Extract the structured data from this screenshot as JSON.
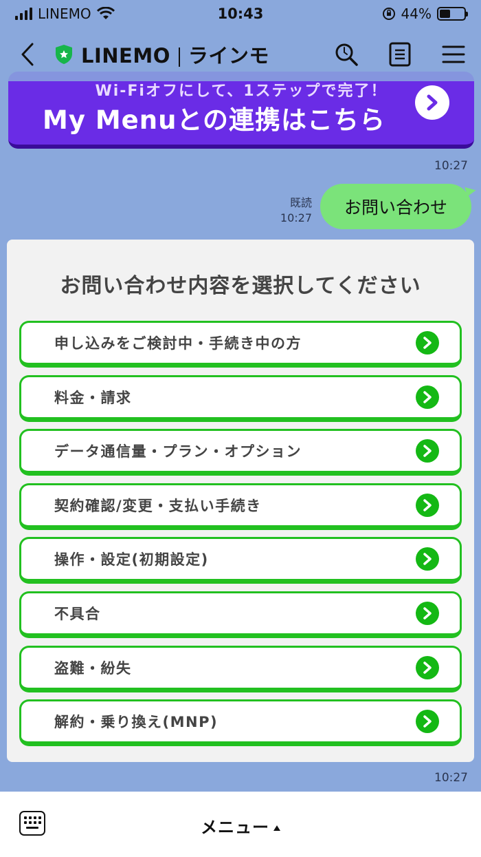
{
  "status": {
    "carrier": "LINEMO",
    "time": "10:43",
    "battery": "44%",
    "battery_level": 0.44
  },
  "header": {
    "title": "LINEMO",
    "subtitle": "ラインモ"
  },
  "banner": {
    "top_text": "Wi-Fiオフにして、1ステップで完了！",
    "main_text": "My Menuとの連携はこちら"
  },
  "messages": {
    "banner_time": "10:27",
    "read_label": "既読",
    "sent_time": "10:27",
    "sent_text": "お問い合わせ",
    "card_time": "10:27"
  },
  "inquiry": {
    "title": "お問い合わせ内容を選択してください",
    "options": [
      "申し込みをご検討中・手続き中の方",
      "料金・請求",
      "データ通信量・プラン・オプション",
      "契約確認/変更・支払い手続き",
      "操作・設定(初期設定)",
      "不具合",
      "盗難・紛失",
      "解約・乗り換え(MNP)"
    ]
  },
  "bottom": {
    "menu_label": "メニュー"
  },
  "colors": {
    "chat_bg": "#8aa8dc",
    "banner": "#6a2ce6",
    "bubble": "#7be37a",
    "option_border": "#22c020"
  },
  "icons": [
    "back-arrow-icon",
    "shield-icon",
    "search-icon",
    "notes-icon",
    "hamburger-menu-icon",
    "keyboard-icon",
    "chevron-right-icon",
    "wifi-icon",
    "orientation-lock-icon",
    "battery-icon"
  ]
}
